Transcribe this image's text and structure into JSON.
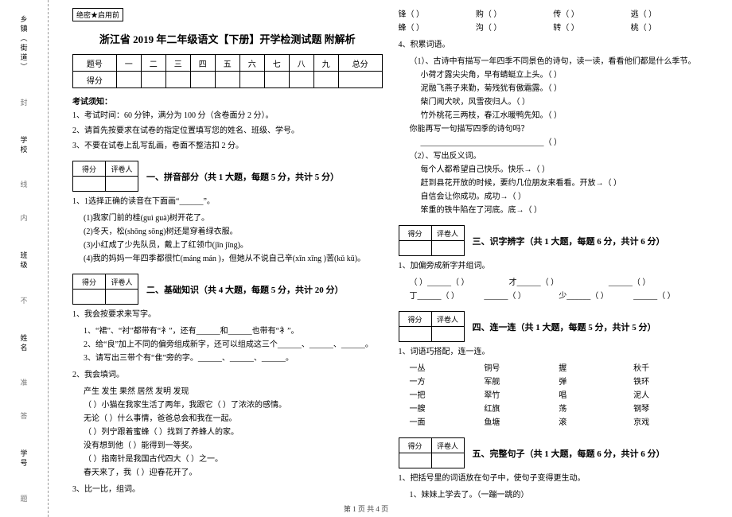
{
  "margin": {
    "l1": "乡镇（街道）",
    "l2": "学校",
    "l3": "班级",
    "l4": "姓名",
    "l5": "学号",
    "d1": "封",
    "d2": "线",
    "d3": "内",
    "d4": "不",
    "d5": "准",
    "d6": "答",
    "d7": "题"
  },
  "secret": "绝密★启用前",
  "title": "浙江省 2019 年二年级语文【下册】开学检测试题 附解析",
  "score_table": {
    "header": [
      "题号",
      "一",
      "二",
      "三",
      "四",
      "五",
      "六",
      "七",
      "八",
      "九",
      "总分"
    ],
    "row_label": "得分"
  },
  "notice_heading": "考试须知：",
  "notices": [
    "1、考试时间：60 分钟，满分为 100 分（含卷面分 2 分）。",
    "2、请首先按要求在试卷的指定位置填写您的姓名、班级、学号。",
    "3、不要在试卷上乱写乱画，卷面不整洁扣 2 分。"
  ],
  "small_table": {
    "c1": "得分",
    "c2": "评卷人"
  },
  "sec1_title": "一、拼音部分（共 1 大题，每题 5 分，共计 5 分）",
  "sec1_q": "1、1选择正确的读音在下面画“______”。",
  "sec1_items": [
    "(1)我家门前的桂(guì  guà)树开花了。",
    "(2)冬天，松(shōng  sōng)树还是穿着绿衣服。",
    "(3)小红成了少先队员，戴上了红领巾(jīn  jǐng)。",
    "(4)我的妈妈一年四季都很忙(máng  mán )，但她从不说自己辛(xīn  xīng )苦(kǔ  kū)。"
  ],
  "sec2_title": "二、基础知识（共 4 大题，每题 5 分，共计 20 分）",
  "sec2_q1": "1、我会按要求来写字。",
  "sec2_q1_items": [
    "1、“裙”、“衬”都带有“衤”，还有______和______也带有“衤”。",
    "2、给“良”加上不同的偏旁组成新字，还可以组成这三个______、______、______。",
    "3、请写出三带个有“隹”旁的字。______、______、______。"
  ],
  "sec2_q2": "2、我会填词。",
  "sec2_q2_words": "产生    发生    果然    居然    发明    发现",
  "sec2_q2_items": [
    "（   ）小猫在我家生活了两年，我跟它（   ）了浓浓的感情。",
    "        无论（   ）什么事情，爸爸总会和我在一起。",
    "（   ）列宁跟着蜜蜂（   ）找到了养蜂人的家。",
    "        没有想到他（   ）能得到一等奖。",
    "（   ）指南针是我国古代四大（   ）之一。",
    "        春天来了，我（   ）迎春花开了。"
  ],
  "sec2_q3": "3、比一比，组词。",
  "right_top_rows": [
    [
      "锋（    ）",
      "购（    ）",
      "传（    ）",
      "逃（    ）"
    ],
    [
      "蜂（    ）",
      "沟（    ）",
      "转（    ）",
      "桃（    ）"
    ]
  ],
  "sec2_q4": "4、积累词语。",
  "sec2_q4_a": "（1）、古诗中有描写一年四季不同景色的诗句，读一读，看看他们都是什么季节。",
  "sec2_q4_a_items": [
    "小荷才露尖尖角，早有蜻蜓立上头。（      ）",
    "泥融飞燕子来勤，菊残犹有傲霜露。（      ）",
    "柴门闻犬吠，风雪夜归人。（      ）",
    "竹外桃花三两枝，春江水暖鸭先知。（      ）"
  ],
  "sec2_q4_b_prompt": "你能再写一句描写四季的诗句吗？",
  "sec2_q4_b_blank": "_______________________________（      ）",
  "sec2_q4_c": "（2）、写出反义词。",
  "sec2_q4_c_items": [
    "每个人都希望自己快乐。快乐→（      ）",
    "赶到县花开放的时候，要约几位朋友来看看。开放→（      ）",
    "自信会让你成功。成功→（      ）",
    "笨重的铁牛陷在了河底。底→（      ）"
  ],
  "sec3_title": "三、识字辨字（共 1 大题，每题 6 分，共计 6 分）",
  "sec3_q": "1、加偏旁成新字并组词。",
  "sec3_rows": [
    [
      "（    ）______（    ）",
      "才______（    ）",
      "______（    ）"
    ],
    [
      "丁______（    ）",
      "______（    ）",
      "少______（    ）",
      "______（    ）"
    ]
  ],
  "sec4_title": "四、连一连（共 1 大题，每题 5 分，共计 5 分）",
  "sec4_q": "1、词语巧搭配，连一连。",
  "sec4_rows": [
    [
      "一丛",
      "铜号",
      "握",
      "秋千"
    ],
    [
      "一方",
      "军舰",
      "弹",
      "铁环"
    ],
    [
      "一把",
      "翠竹",
      "唱",
      "泥人"
    ],
    [
      "一艘",
      "红旗",
      "荡",
      "钢琴"
    ],
    [
      "一面",
      "鱼塘",
      "滚",
      "京戏"
    ]
  ],
  "sec5_title": "五、完整句子（共 1 大题，每题 6 分，共计 6 分）",
  "sec5_q": "1、把括号里的词语放在句子中，使句子变得更生动。",
  "sec5_item": "1、妹妹上学去了。（一蹦一跳的）",
  "footer": "第 1 页 共 4 页"
}
